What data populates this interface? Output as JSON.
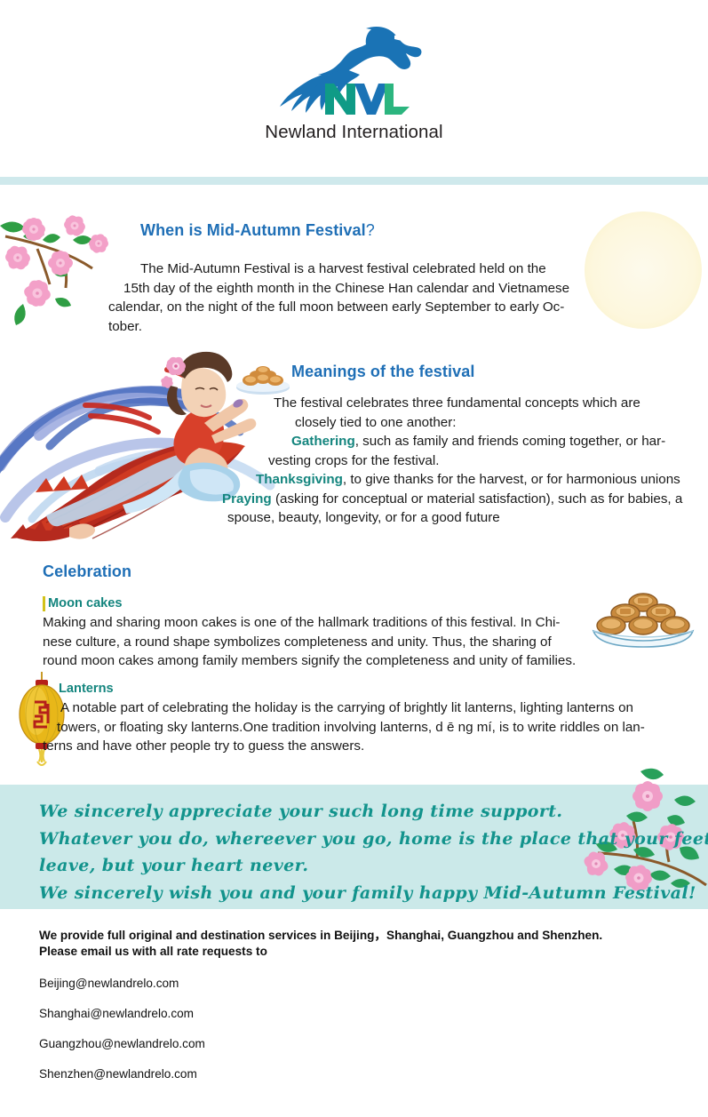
{
  "header": {
    "logo_icon": "leaping-panther-logo",
    "company_name": "Newland International"
  },
  "sections": {
    "when": {
      "title": "When is Mid-Autumn Festival",
      "title_mark": "?",
      "lines": [
        "The Mid-Autumn Festival is a harvest festival celebrated held on the",
        "15th day of the eighth month in the Chinese Han calendar and Vietnamese",
        "calendar, on the night of the full moon between early September to early Oc-",
        "tober."
      ]
    },
    "meanings": {
      "title": "Meanings of the festival",
      "intro_lines": [
        "The festival celebrates three fundamental concepts which are",
        "closely tied to one another:"
      ],
      "concepts": [
        {
          "keyword": "Gathering",
          "line1_rest": ", such as family and friends coming together, or har-",
          "line2": "vesting crops for the festival."
        },
        {
          "keyword": "Thanksgiving",
          "line1_rest": ", to give thanks for the harvest, or for harmonious unions",
          "line2": ""
        },
        {
          "keyword": "Praying",
          "line1_rest": " (asking for conceptual or material satisfaction), such as for babies, a",
          "line2": "spouse, beauty, longevity, or for a good future"
        }
      ]
    },
    "celebration": {
      "title": "Celebration",
      "subsections": [
        {
          "heading": "Moon cakes",
          "lines": [
            "Making and sharing moon cakes is one of the hallmark traditions of this festival. In Chi-",
            "nese culture, a round shape symbolizes completeness and unity. Thus, the sharing of",
            "round moon cakes among family members signify the completeness and unity of families."
          ]
        },
        {
          "heading": "Lanterns",
          "lines": [
            "A notable part of celebrating the holiday is the carrying of brightly lit lanterns, lighting lanterns on",
            "towers, or floating sky lanterns.One tradition involving lanterns, d ē ng mí, is to write riddles on lan-",
            "terns and have other people try to guess the answers."
          ]
        }
      ]
    }
  },
  "greeting": {
    "lines": [
      "We sincerely appreciate your such long time support.",
      "Whatever you do, whereever you go, home is the place that your feet may",
      "leave, but your heart never.",
      "We sincerely wish you and your family happy Mid-Autumn Festival!"
    ]
  },
  "footer": {
    "lead_lines": [
      "We provide full original and destination services in Beijing，Shanghai, Guangzhou and Shenzhen.",
      "Please email us with all rate requests to"
    ],
    "emails": [
      "Beijing@newlandrelo.com",
      "Shanghai@newlandrelo.com",
      "Guangzhou@newlandrelo.com",
      "Shenzhen@newlandrelo.com"
    ]
  },
  "decor": {
    "moon": "full-moon",
    "flowers_top_left": "cherry-blossom-branch",
    "flowers_band": "cherry-blossom-branch",
    "fairy": "change-flying-fairy",
    "mooncake_plate": "mooncakes-on-plate",
    "lantern": "chinese-lantern"
  },
  "colors": {
    "heading_blue": "#1f6fb6",
    "accent_teal": "#14857e",
    "band_teal": "#cbe9e9",
    "rule_teal": "#cfe9ec",
    "logo_blue": "#1a73b5",
    "logo_green": "#129a6e",
    "sub_bar_yellow": "#d2c21a",
    "moon_cream": "#fdf7dd"
  }
}
